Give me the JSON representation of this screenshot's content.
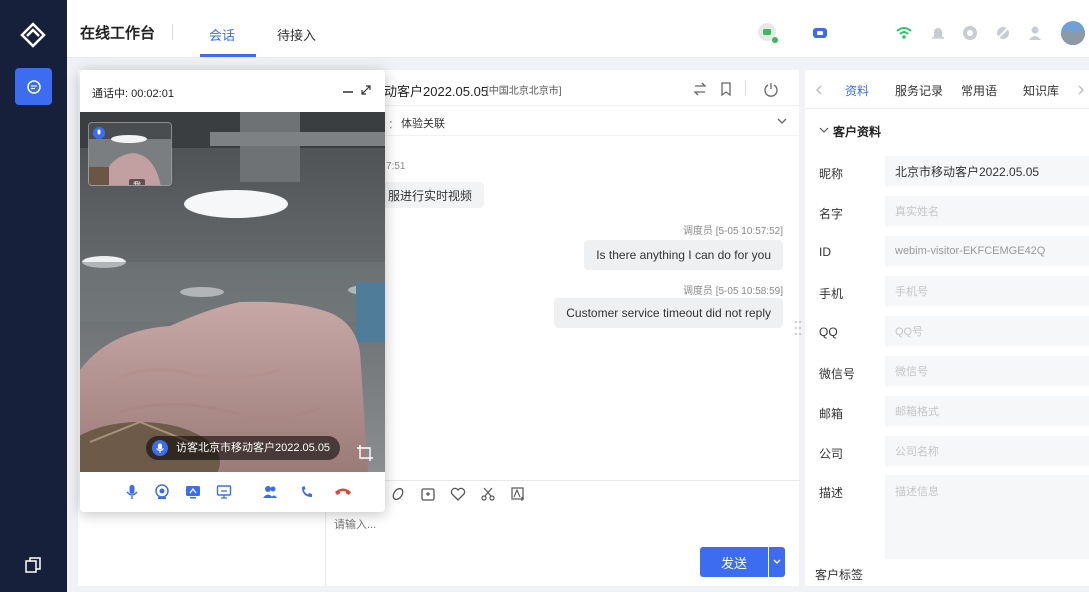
{
  "header": {
    "app_title": "在线工作台",
    "tabs": [
      {
        "label": "会话"
      },
      {
        "label": "待接入"
      }
    ]
  },
  "call": {
    "status": "通话中: 00:02:01",
    "self_tag": "我",
    "visitor_caption": "访客北京市移动客户2022.05.05"
  },
  "chat": {
    "visitor_name": "动客户2022.05.05",
    "location": "[中国北京北京市]",
    "sub_label": "：",
    "sub_value": "体验关联",
    "left_time": "7:51",
    "left_message": "服进行实时视频",
    "messages": [
      {
        "meta": "调度员 [5-05 10:57:52]",
        "text": "Is there anything I can do for you"
      },
      {
        "meta": "调度员 [5-05 10:58:59]",
        "text": "Customer service timeout did not reply"
      }
    ],
    "input_placeholder": "请输入...",
    "send_label": "发送"
  },
  "right": {
    "tabs": [
      {
        "label": "资料"
      },
      {
        "label": "服务记录"
      },
      {
        "label": "常用语"
      },
      {
        "label": "知识库"
      }
    ],
    "section_title": "客户资料",
    "fields": [
      {
        "label": "昵称",
        "value": "北京市移动客户2022.05.05",
        "placeholder": ""
      },
      {
        "label": "名字",
        "value": "",
        "placeholder": "真实姓名"
      },
      {
        "label": "ID",
        "value": "webim-visitor-EKFCEMGE42Q",
        "placeholder": ""
      },
      {
        "label": "手机",
        "value": "",
        "placeholder": "手机号"
      },
      {
        "label": "QQ",
        "value": "",
        "placeholder": "QQ号"
      },
      {
        "label": "微信号",
        "value": "",
        "placeholder": "微信号"
      },
      {
        "label": "邮箱",
        "value": "",
        "placeholder": "邮箱格式"
      },
      {
        "label": "公司",
        "value": "",
        "placeholder": "公司名称"
      },
      {
        "label": "描述",
        "value": "",
        "placeholder": "描述信息"
      }
    ],
    "tags_label": "客户标签"
  },
  "colors": {
    "accent": "#3c6df0",
    "rail": "#16203a",
    "hangup": "#e0463b"
  }
}
